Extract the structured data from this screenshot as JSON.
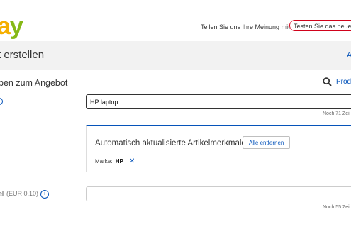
{
  "header": {
    "logo_part1": "a",
    "logo_part2": "y",
    "feedback_text": "Teilen Sie uns Ihre Meinung mit",
    "try_new_label": "Testen Sie das neue E"
  },
  "titlebar": {
    "title": "t erstellen",
    "link": "A"
  },
  "section": {
    "title": "ben zum Angebot",
    "search_link": "Prod"
  },
  "title_field": {
    "value": "HP laptop",
    "counter": "Noch 71  Zei"
  },
  "attributes": {
    "heading": "Automatisch aktualisierte Artikelmerkmale",
    "remove_all": "Alle entfernen",
    "brand_label": "Marke:",
    "brand_value": "HP",
    "remove_icon": "✕"
  },
  "subtitle_field": {
    "label": "el",
    "fee": "(EUR 0,10)",
    "info_glyph": "i",
    "counter": "Noch 55  Zei"
  },
  "colors": {
    "link_blue": "#0654ba",
    "highlight_red": "#d0021b",
    "titlebar_bg": "#f2f2f2"
  }
}
